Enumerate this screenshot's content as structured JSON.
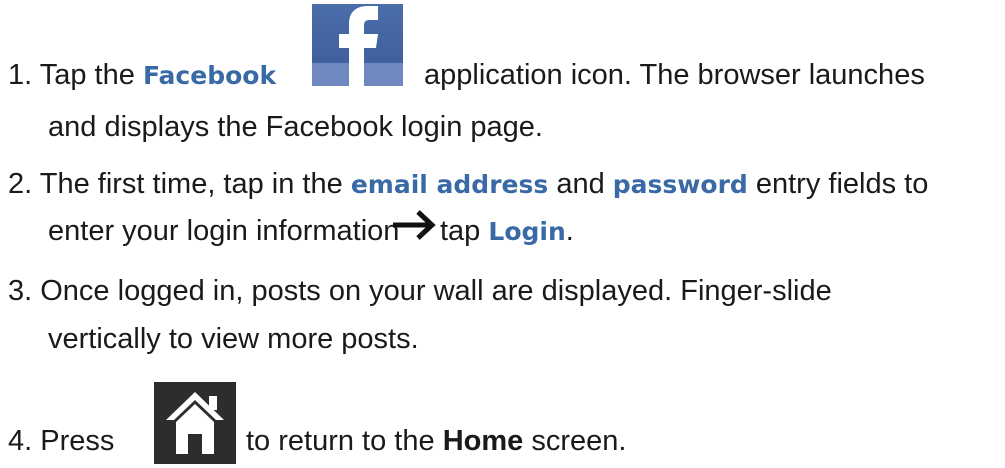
{
  "step1": {
    "number": "1.",
    "text_a": "Tap the",
    "facebook": "Facebook",
    "text_b": "application icon. The browser launches",
    "line2": "and displays the Facebook login page."
  },
  "step2": {
    "number": "2.",
    "text_a": "The first time, tap in the",
    "email": "email address",
    "and": "and",
    "password": "password",
    "text_b": "entry fields to",
    "line2_a": "enter your login information",
    "tap": "tap",
    "login": "Login",
    "period": "."
  },
  "step3": {
    "number": "3.",
    "line1": "Once logged in, posts on your wall are displayed. Finger-slide",
    "line2": "vertically to view more posts."
  },
  "step4": {
    "number": "4.",
    "press": "Press",
    "text_a": "to return to the",
    "home": "Home",
    "text_b": "screen."
  },
  "icons": {
    "facebook": "facebook-f-icon",
    "arrow": "right-arrow-icon",
    "home": "home-house-icon"
  },
  "colors": {
    "keyword": "#3a6aa5",
    "facebook_blue": "#3b5a99",
    "home_icon_bg": "#2d2d2d"
  }
}
